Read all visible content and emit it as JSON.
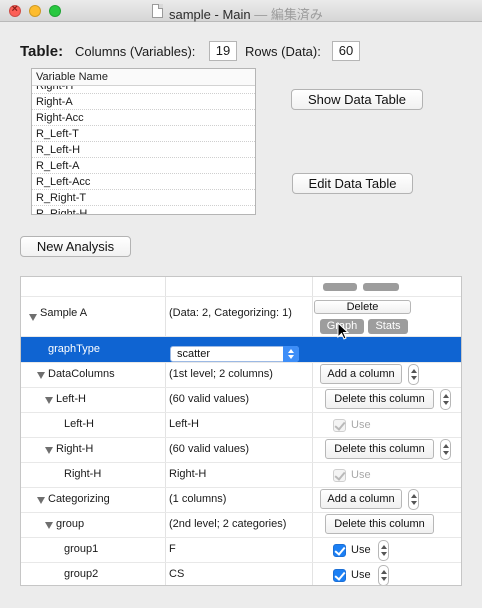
{
  "window": {
    "title": "sample - Main",
    "subtitle": "— 編集済み"
  },
  "header": {
    "table_label": "Table:",
    "columns_label": "Columns (Variables):",
    "columns_value": "19",
    "rows_label": "Rows (Data):",
    "rows_value": "60"
  },
  "variables": {
    "header": "Variable Name",
    "items": [
      "Right-H",
      "Right-A",
      "Right-Acc",
      "R_Left-T",
      "R_Left-H",
      "R_Left-A",
      "R_Left-Acc",
      "R_Right-T",
      "R_Right-H"
    ]
  },
  "buttons": {
    "show_data_table": "Show Data Table",
    "edit_data_table": "Edit Data Table",
    "new_analysis": "New Analysis"
  },
  "outline": {
    "top_buttons": {
      "delete": "Delete",
      "graph": "Graph",
      "stats": "Stats"
    },
    "rows": [
      {
        "name": "Sample A",
        "info": "(Data: 2, Categorizing: 1)"
      },
      {
        "name": "graphType",
        "select_value": "scatter"
      },
      {
        "name": "DataColumns",
        "info": "(1st level; 2 columns)",
        "action": "Add a column"
      },
      {
        "name": "Left-H",
        "info": "(60 valid values)",
        "action": "Delete this column"
      },
      {
        "name": "Left-H",
        "info": "Left-H",
        "check_label": "Use",
        "checked": true,
        "enabled": false
      },
      {
        "name": "Right-H",
        "info": "(60 valid values)",
        "action": "Delete this column"
      },
      {
        "name": "Right-H",
        "info": "Right-H",
        "check_label": "Use",
        "checked": true,
        "enabled": false
      },
      {
        "name": "Categorizing",
        "info": "(1 columns)",
        "action": "Add a column"
      },
      {
        "name": "group",
        "info": "(2nd level; 2 categories)",
        "action": "Delete this column"
      },
      {
        "name": "group1",
        "info": "F",
        "check_label": "Use",
        "checked": true,
        "enabled": true
      },
      {
        "name": "group2",
        "info": "CS",
        "check_label": "Use",
        "checked": true,
        "enabled": true
      }
    ]
  },
  "colors": {
    "selection": "#0f64d2",
    "checkbox": "#1b7ff4"
  }
}
